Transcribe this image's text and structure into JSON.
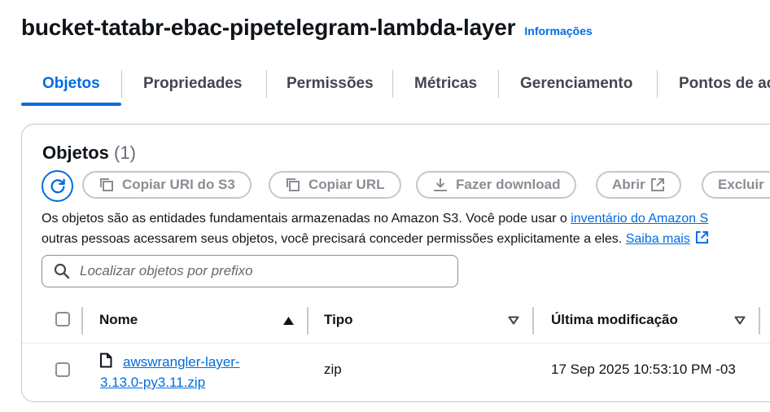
{
  "header": {
    "title": "bucket-tatabr-ebac-pipetelegram-lambda-layer",
    "info_link": "Informações"
  },
  "tabs": [
    {
      "label": "Objetos",
      "active": true
    },
    {
      "label": "Propriedades",
      "active": false
    },
    {
      "label": "Permissões",
      "active": false
    },
    {
      "label": "Métricas",
      "active": false
    },
    {
      "label": "Gerenciamento",
      "active": false
    },
    {
      "label": "Pontos de ac",
      "active": false
    }
  ],
  "objects_panel": {
    "title": "Objetos",
    "count": "(1)",
    "actions": {
      "refresh_icon": "refresh-icon",
      "copy_uri": "Copiar URI do S3",
      "copy_url": "Copiar URL",
      "download": "Fazer download",
      "open": "Abrir",
      "delete": "Excluir"
    },
    "description": {
      "line1_text": "Os objetos são as entidades fundamentais armazenadas no Amazon S3. Você pode usar o ",
      "line1_link": "inventário do Amazon S",
      "line2_text": "outras pessoas acessarem seus objetos, você precisará conceder permissões explicitamente a eles. ",
      "line2_link": "Saiba mais"
    },
    "search": {
      "placeholder": "Localizar objetos por prefixo"
    },
    "table": {
      "columns": [
        "Nome",
        "Tipo",
        "Última modificação"
      ],
      "rows": [
        {
          "name_line1": "awswrangler-layer-",
          "name_line2": "3.13.0-py3.11.zip",
          "type": "zip",
          "last_modified": "17 Sep 2025 10:53:10 PM -03"
        }
      ]
    }
  },
  "colors": {
    "accent": "#006ce0",
    "text": "#0f141a",
    "disabled": "#8c8c94",
    "border": "#c6c6cd"
  }
}
